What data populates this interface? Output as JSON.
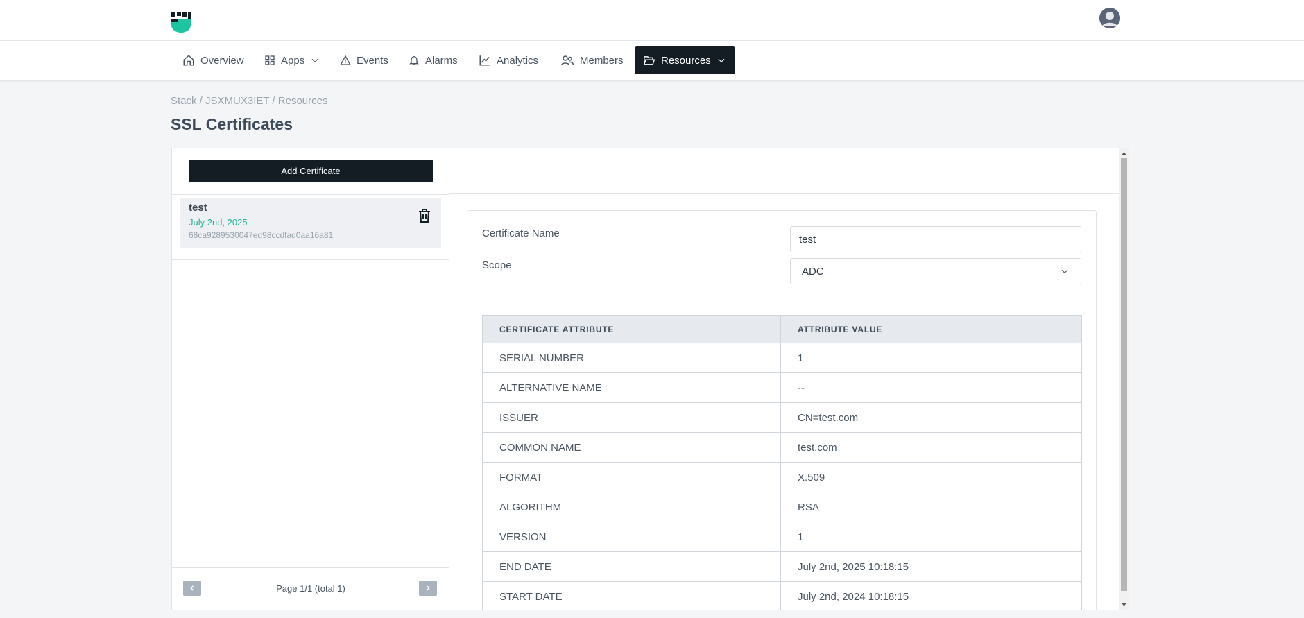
{
  "nav": {
    "items": [
      {
        "label": "Overview",
        "icon": "home-icon"
      },
      {
        "label": "Apps",
        "icon": "grid-icon"
      },
      {
        "label": "Events",
        "icon": "warning-icon"
      },
      {
        "label": "Alarms",
        "icon": "bell-icon"
      },
      {
        "label": "Analytics",
        "icon": "chart-line-icon"
      },
      {
        "label": "Members",
        "icon": "users-icon"
      },
      {
        "label": "Resources",
        "icon": "folder-open-icon"
      }
    ],
    "active": "Resources"
  },
  "breadcrumb": "Stack / JSXMUX3IET / Resources",
  "page_title": "SSL Certificates",
  "sidebar": {
    "add_button": "Add Certificate",
    "certificates": [
      {
        "name": "test",
        "date": "July 2nd, 2025",
        "id": "68ca9289530047ed98ccdfad0aa16a81"
      }
    ],
    "pagination": "Page 1/1 (total 1)"
  },
  "detail": {
    "name_label": "Certificate Name",
    "name_value": "test",
    "scope_label": "Scope",
    "scope_value": "ADC",
    "table": {
      "headers": [
        "CERTIFICATE ATTRIBUTE",
        "ATTRIBUTE VALUE"
      ],
      "rows": [
        [
          "SERIAL NUMBER",
          "1"
        ],
        [
          "ALTERNATIVE NAME",
          "--"
        ],
        [
          "ISSUER",
          "CN=test.com"
        ],
        [
          "COMMON NAME",
          "test.com"
        ],
        [
          "FORMAT",
          "X.509"
        ],
        [
          "ALGORITHM",
          "RSA"
        ],
        [
          "VERSION",
          "1"
        ],
        [
          "END DATE",
          "July 2nd, 2025 10:18:15"
        ],
        [
          "START DATE",
          "July 2nd, 2024 10:18:15"
        ]
      ]
    }
  },
  "colors": {
    "nav_active_bg": "#141d24",
    "accent_green": "#22b59a",
    "logo_teal": "#1fc4a0"
  }
}
